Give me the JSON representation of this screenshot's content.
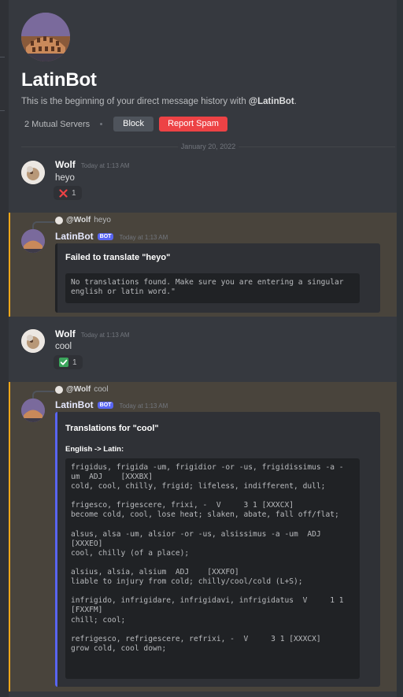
{
  "hero": {
    "title": "LatinBot",
    "subtitle_prefix": "This is the beginning of your direct message history with ",
    "subtitle_user": "@LatinBot",
    "subtitle_suffix": ".",
    "mutual_servers": "2 Mutual Servers",
    "block_label": "Block",
    "report_label": "Report Spam"
  },
  "date_divider": "January 20, 2022",
  "colors": {
    "accent": "#5865f2",
    "danger": "#ed4245",
    "mention_highlight": "#faa81a"
  },
  "messages": [
    {
      "author": "Wolf",
      "timestamp": "Today at 1:13 AM",
      "text": "heyo",
      "reaction": {
        "emoji": "✕",
        "icon": "cross-mark-icon",
        "count": "1"
      }
    },
    {
      "reply_to": {
        "author": "@Wolf",
        "text": "heyo"
      },
      "author": "LatinBot",
      "badge": "BOT",
      "timestamp": "Today at 1:13 AM",
      "embed": {
        "title": "Failed to translate \"heyo\"",
        "code": "No translations found. Make sure you are entering a singular\nenglish or latin word.\""
      }
    },
    {
      "author": "Wolf",
      "timestamp": "Today at 1:13 AM",
      "text": "cool",
      "reaction": {
        "emoji": "✔",
        "icon": "check-mark-icon",
        "count": "1"
      }
    },
    {
      "reply_to": {
        "author": "@Wolf",
        "text": "cool"
      },
      "author": "LatinBot",
      "badge": "BOT",
      "timestamp": "Today at 1:13 AM",
      "embed": {
        "title": "Translations for \"cool\"",
        "field_name": "English -> Latin:",
        "code": "frigidus, frigida -um, frigidior -or -us, frigidissimus -a -\num  ADJ    [XXXBX]\ncold, cool, chilly, frigid; lifeless, indifferent, dull;\n\nfrigesco, frigescere, frixi, -  V     3 1 [XXXCX]\nbecome cold, cool, lose heat; slaken, abate, fall off/flat;\n\nalsus, alsa -um, alsior -or -us, alsissimus -a -um  ADJ\n[XXXEO]\ncool, chilly (of a place);\n\nalsius, alsia, alsium  ADJ    [XXXFO]\nliable to injury from cold; chilly/cool/cold (L+S);\n\ninfrigido, infrigidare, infrigidavi, infrigidatus  V     1 1\n[FXXFM]\nchill; cool;\n\nrefrigesco, refrigescere, refrixi, -  V     3 1 [XXXCX]\ngrow cold, cool down;"
      }
    }
  ]
}
